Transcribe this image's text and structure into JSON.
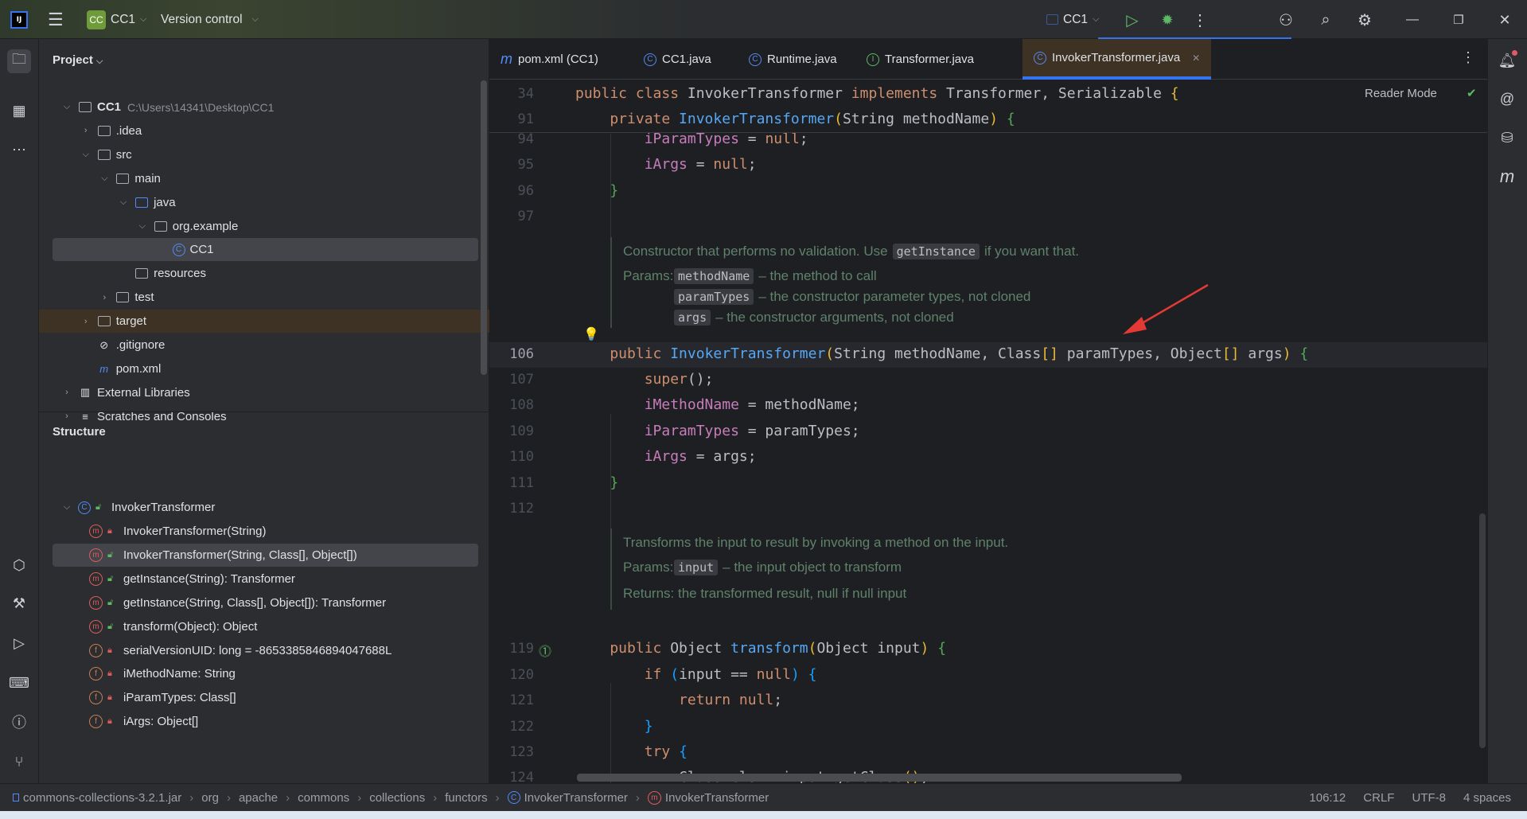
{
  "titlebar": {
    "project_badge": "CC",
    "project_name": "CC1",
    "vcs_label": "Version control",
    "run_config": "CC1"
  },
  "project_panel": {
    "title": "Project",
    "tree": [
      {
        "label": "CC1",
        "path": "C:\\Users\\14341\\Desktop\\CC1",
        "level": 0,
        "expanded": true,
        "icon": "module-folder",
        "bold": true
      },
      {
        "label": ".idea",
        "level": 1,
        "expanded": false,
        "icon": "folder"
      },
      {
        "label": "src",
        "level": 1,
        "expanded": true,
        "icon": "folder"
      },
      {
        "label": "main",
        "level": 2,
        "expanded": true,
        "icon": "folder"
      },
      {
        "label": "java",
        "level": 3,
        "expanded": true,
        "icon": "source-folder"
      },
      {
        "label": "org.example",
        "level": 4,
        "expanded": true,
        "icon": "package"
      },
      {
        "label": "CC1",
        "level": 5,
        "icon": "class",
        "selected": true
      },
      {
        "label": "resources",
        "level": 3,
        "icon": "resources-folder"
      },
      {
        "label": "test",
        "level": 2,
        "expanded": false,
        "icon": "folder"
      },
      {
        "label": "target",
        "level": 1,
        "expanded": false,
        "icon": "folder",
        "highlighted": true
      },
      {
        "label": ".gitignore",
        "level": 1,
        "icon": "ignore-file"
      },
      {
        "label": "pom.xml",
        "level": 1,
        "icon": "maven"
      },
      {
        "label": "External Libraries",
        "level": 0,
        "expanded": false,
        "icon": "library"
      },
      {
        "label": "Scratches and Consoles",
        "level": 0,
        "expanded": false,
        "icon": "scratches"
      }
    ]
  },
  "structure_panel": {
    "title": "Structure",
    "root": {
      "label": "InvokerTransformer",
      "icon": "class"
    },
    "items": [
      {
        "label": "InvokerTransformer(String)",
        "kind": "method",
        "access": "private"
      },
      {
        "label": "InvokerTransformer(String, Class[], Object[])",
        "kind": "method",
        "access": "public",
        "selected": true
      },
      {
        "label": "getInstance(String): Transformer",
        "kind": "static-method",
        "access": "public"
      },
      {
        "label": "getInstance(String, Class[], Object[]): Transformer",
        "kind": "static-method",
        "access": "public"
      },
      {
        "label": "transform(Object): Object",
        "kind": "method",
        "access": "public"
      },
      {
        "label": "serialVersionUID: long = -8653385846894047688L",
        "kind": "static-field",
        "access": "private"
      },
      {
        "label": "iMethodName: String",
        "kind": "field",
        "access": "private"
      },
      {
        "label": "iParamTypes: Class[]",
        "kind": "field",
        "access": "private"
      },
      {
        "label": "iArgs: Object[]",
        "kind": "field",
        "access": "private"
      }
    ]
  },
  "tabs": [
    {
      "label": "pom.xml (CC1)",
      "icon": "maven"
    },
    {
      "label": "CC1.java",
      "icon": "class"
    },
    {
      "label": "Runtime.java",
      "icon": "class"
    },
    {
      "label": "Transformer.java",
      "icon": "interface"
    },
    {
      "label": "InvokerTransformer.java",
      "icon": "class",
      "active": true
    }
  ],
  "editor": {
    "reader_mode": "Reader Mode",
    "current_line": "106",
    "sticky": [
      {
        "n": "34",
        "toks": [
          [
            "public class ",
            "k"
          ],
          [
            "InvokerTransformer ",
            "t"
          ],
          [
            "implements ",
            "k"
          ],
          [
            "Transformer, Serializable ",
            "t"
          ],
          [
            "{",
            "y"
          ]
        ]
      },
      {
        "n": "91",
        "toks": [
          [
            "    private ",
            "k"
          ],
          [
            "InvokerTransformer",
            "m"
          ],
          [
            "(",
            "y"
          ],
          [
            "String methodName",
            "t"
          ],
          [
            ")",
            "y"
          ],
          [
            " ",
            "t"
          ],
          [
            "{",
            "g"
          ]
        ]
      }
    ],
    "lines": [
      {
        "n": "94",
        "toks": [
          [
            "        ",
            "t"
          ],
          [
            "iParamTypes",
            "f"
          ],
          [
            " = ",
            "t"
          ],
          [
            "null",
            "k"
          ],
          [
            ";",
            "t"
          ]
        ]
      },
      {
        "n": "95",
        "toks": [
          [
            "        ",
            "t"
          ],
          [
            "iArgs",
            "f"
          ],
          [
            " = ",
            "t"
          ],
          [
            "null",
            "k"
          ],
          [
            ";",
            "t"
          ]
        ]
      },
      {
        "n": "96",
        "toks": [
          [
            "    ",
            "t"
          ],
          [
            "}",
            "g"
          ]
        ]
      },
      {
        "n": "97",
        "toks": []
      },
      {
        "doc": {
          "text_before": "Constructor that performs no validation. Use ",
          "code": "getInstance",
          "text_after": " if you want that.",
          "params_label": "Params:",
          "params": [
            {
              "name": "methodName",
              "desc": "– the method to call"
            },
            {
              "name": "paramTypes",
              "desc": "– the constructor parameter types, not cloned"
            },
            {
              "name": "args",
              "desc": "– the constructor arguments, not cloned"
            }
          ]
        }
      },
      {
        "n": "106",
        "toks": [
          [
            "    public ",
            "k"
          ],
          [
            "InvokerTransformer",
            "m"
          ],
          [
            "(",
            "y"
          ],
          [
            "String methodName, Class",
            "t"
          ],
          [
            "[]",
            "y"
          ],
          [
            " paramTypes, Object",
            "t"
          ],
          [
            "[]",
            "y"
          ],
          [
            " args",
            "t"
          ],
          [
            ")",
            "y"
          ],
          [
            " ",
            "t"
          ],
          [
            "{",
            "g"
          ]
        ]
      },
      {
        "n": "107",
        "toks": [
          [
            "        ",
            "t"
          ],
          [
            "super",
            "k"
          ],
          [
            "();",
            "t"
          ]
        ]
      },
      {
        "n": "108",
        "toks": [
          [
            "        ",
            "t"
          ],
          [
            "iMethodName",
            "f"
          ],
          [
            " = methodName;",
            "t"
          ]
        ]
      },
      {
        "n": "109",
        "toks": [
          [
            "        ",
            "t"
          ],
          [
            "iParamTypes",
            "f"
          ],
          [
            " = paramTypes;",
            "t"
          ]
        ]
      },
      {
        "n": "110",
        "toks": [
          [
            "        ",
            "t"
          ],
          [
            "iArgs",
            "f"
          ],
          [
            " = args;",
            "t"
          ]
        ]
      },
      {
        "n": "111",
        "toks": [
          [
            "    ",
            "t"
          ],
          [
            "}",
            "g"
          ]
        ]
      },
      {
        "n": "112",
        "toks": []
      },
      {
        "doc": {
          "text_before": "Transforms the input to result by invoking a method on the input.",
          "params_label": "Params:",
          "params": [
            {
              "name": "input",
              "desc": "– the input object to transform"
            }
          ],
          "returns": "Returns: the transformed result, null if null input"
        }
      },
      {
        "n": "119",
        "toks": [
          [
            "    public ",
            "k"
          ],
          [
            "Object ",
            "t"
          ],
          [
            "transform",
            "m"
          ],
          [
            "(",
            "y"
          ],
          [
            "Object input",
            "t"
          ],
          [
            ")",
            "y"
          ],
          [
            " ",
            "t"
          ],
          [
            "{",
            "g"
          ]
        ]
      },
      {
        "n": "120",
        "toks": [
          [
            "        ",
            "t"
          ],
          [
            "if ",
            "k"
          ],
          [
            "(",
            "bl"
          ],
          [
            "input == ",
            "t"
          ],
          [
            "null",
            "k"
          ],
          [
            ")",
            "bl"
          ],
          [
            " ",
            "t"
          ],
          [
            "{",
            "bl"
          ]
        ]
      },
      {
        "n": "121",
        "toks": [
          [
            "            ",
            "t"
          ],
          [
            "return null",
            "k"
          ],
          [
            ";",
            "t"
          ]
        ]
      },
      {
        "n": "122",
        "toks": [
          [
            "        ",
            "t"
          ],
          [
            "}",
            "bl"
          ]
        ]
      },
      {
        "n": "123",
        "toks": [
          [
            "        ",
            "t"
          ],
          [
            "try ",
            "k"
          ],
          [
            "{",
            "bl"
          ]
        ]
      },
      {
        "n": "124",
        "toks": [
          [
            "            Class cls = input.getClass",
            "t"
          ],
          [
            "()",
            "y"
          ],
          [
            ";",
            "t"
          ]
        ]
      }
    ]
  },
  "statusbar": {
    "breadcrumbs": [
      {
        "label": "commons-collections-3.2.1.jar",
        "icon": "jar"
      },
      {
        "label": "org"
      },
      {
        "label": "apache"
      },
      {
        "label": "commons"
      },
      {
        "label": "collections"
      },
      {
        "label": "functors"
      },
      {
        "label": "InvokerTransformer",
        "icon": "class"
      },
      {
        "label": "InvokerTransformer",
        "icon": "method"
      }
    ],
    "position": "106:12",
    "line_ending": "CRLF",
    "encoding": "UTF-8",
    "indent": "4 spaces"
  },
  "colors": {
    "accent": "#3574f0",
    "keyword": "#cf8e6d",
    "method": "#56a8f5",
    "field": "#c77dbb",
    "doc": "#5f826b",
    "annotation_arrow": "#e53935"
  }
}
